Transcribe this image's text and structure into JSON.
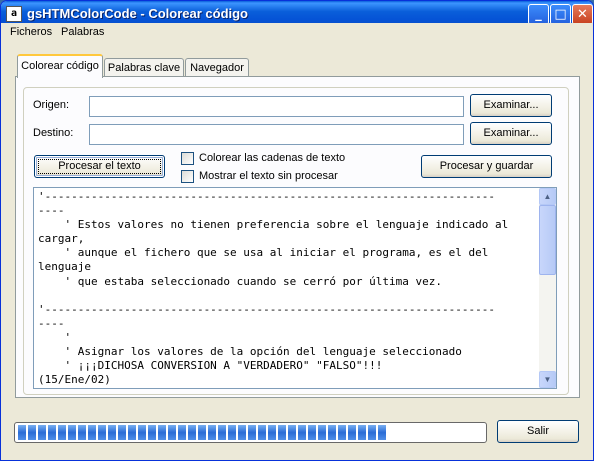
{
  "window": {
    "title": "gsHTMColorCode - Colorear código",
    "icon_label": "a",
    "controls": {
      "minimize": "minimize-icon",
      "maximize": "maximize-icon",
      "close": "close-icon"
    }
  },
  "menu": {
    "items": [
      "Ficheros",
      "Palabras"
    ]
  },
  "tabs": [
    {
      "label": "Colorear código",
      "active": true
    },
    {
      "label": "Palabras clave",
      "active": false
    },
    {
      "label": "Navegador",
      "active": false
    }
  ],
  "form": {
    "origen_label": "Origen:",
    "origen_value": "",
    "destino_label": "Destino:",
    "destino_value": "",
    "examinar_label": "Examinar...",
    "procesar_texto_label": "Procesar el texto",
    "procesar_guardar_label": "Procesar y guardar",
    "checkboxes": [
      {
        "label": "Colorear las cadenas de texto",
        "checked": false
      },
      {
        "label": "Mostrar el texto sin procesar",
        "checked": false
      }
    ]
  },
  "code": {
    "lines": [
      "'--------------------------------------------------------------------",
      "----",
      "    ' Estos valores no tienen preferencia sobre el lenguaje indicado al",
      "cargar,",
      "    ' aunque el fichero que se usa al iniciar el programa, es el del",
      "lenguaje",
      "    ' que estaba seleccionado cuando se cerró por última vez.",
      "",
      "'--------------------------------------------------------------------",
      "----",
      "    '",
      "    ' Asignar los valores de la opción del lenguaje seleccionado",
      "    ' ¡¡¡DICHOSA CONVERSION A \"VERDADERO\" \"FALSO\"!!!",
      "(15/Ene/02)"
    ],
    "scrollbar": {
      "up_icon": "arrow-up-icon",
      "down_icon": "arrow-down-icon"
    }
  },
  "progress": {
    "value_percent": 79
  },
  "footer": {
    "salir_label": "Salir"
  }
}
